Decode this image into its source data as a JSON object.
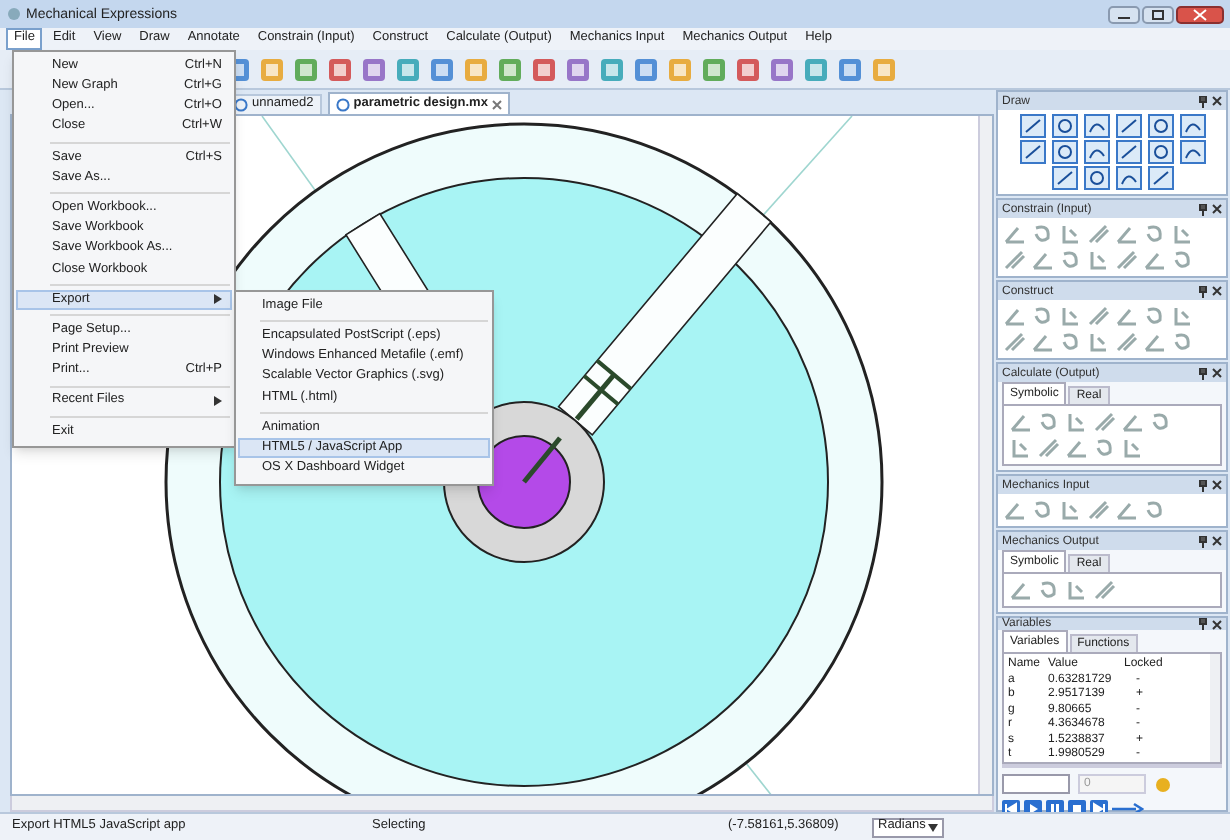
{
  "window": {
    "title": "Mechanical Expressions"
  },
  "menu_bar": [
    {
      "label": "File",
      "selected": true
    },
    {
      "label": "Edit",
      "selected": false
    },
    {
      "label": "View",
      "selected": false
    },
    {
      "label": "Draw",
      "selected": false
    },
    {
      "label": "Annotate",
      "selected": false
    },
    {
      "label": "Constrain (Input)",
      "selected": false
    },
    {
      "label": "Construct",
      "selected": false
    },
    {
      "label": "Calculate (Output)",
      "selected": false
    },
    {
      "label": "Mechanics Input",
      "selected": false
    },
    {
      "label": "Mechanics Output",
      "selected": false
    },
    {
      "label": "Help",
      "selected": false
    }
  ],
  "file_menu": [
    {
      "kind": "item",
      "label": "New",
      "shortcut": "Ctrl+N",
      "submenu": false,
      "selected": false
    },
    {
      "kind": "item",
      "label": "New Graph",
      "shortcut": "Ctrl+G",
      "submenu": false,
      "selected": false
    },
    {
      "kind": "item",
      "label": "Open...",
      "shortcut": "Ctrl+O",
      "submenu": false,
      "selected": false
    },
    {
      "kind": "item",
      "label": "Close",
      "shortcut": "Ctrl+W",
      "submenu": false,
      "selected": false
    },
    {
      "kind": "separator"
    },
    {
      "kind": "item",
      "label": "Save",
      "shortcut": "Ctrl+S",
      "submenu": false,
      "selected": false
    },
    {
      "kind": "item",
      "label": "Save As...",
      "submenu": false,
      "selected": false
    },
    {
      "kind": "separator"
    },
    {
      "kind": "item",
      "label": "Open Workbook...",
      "submenu": false,
      "selected": false
    },
    {
      "kind": "item",
      "label": "Save Workbook",
      "submenu": false,
      "selected": false
    },
    {
      "kind": "item",
      "label": "Save Workbook As...",
      "submenu": false,
      "selected": false
    },
    {
      "kind": "item",
      "label": "Close Workbook",
      "submenu": false,
      "selected": false
    },
    {
      "kind": "separator"
    },
    {
      "kind": "item",
      "label": "Export",
      "submenu": true,
      "selected": true
    },
    {
      "kind": "separator"
    },
    {
      "kind": "item",
      "label": "Page Setup...",
      "submenu": false,
      "selected": false
    },
    {
      "kind": "item",
      "label": "Print Preview",
      "submenu": false,
      "selected": false
    },
    {
      "kind": "item",
      "label": "Print...",
      "shortcut": "Ctrl+P",
      "submenu": false,
      "selected": false
    },
    {
      "kind": "separator"
    },
    {
      "kind": "item",
      "label": "Recent Files",
      "submenu": true,
      "selected": false
    },
    {
      "kind": "separator"
    },
    {
      "kind": "item",
      "label": "Exit",
      "submenu": false,
      "selected": false
    }
  ],
  "export_submenu": [
    {
      "kind": "item",
      "label": "Image File",
      "selected": false
    },
    {
      "kind": "separator"
    },
    {
      "kind": "item",
      "label": "Encapsulated PostScript (.eps)",
      "selected": false
    },
    {
      "kind": "item",
      "label": "Windows Enhanced Metafile (.emf)",
      "selected": false
    },
    {
      "kind": "item",
      "label": "Scalable Vector Graphics (.svg)",
      "selected": false
    },
    {
      "kind": "item",
      "label": "HTML (.html)",
      "selected": false
    },
    {
      "kind": "separator"
    },
    {
      "kind": "item",
      "label": "Animation",
      "selected": false
    },
    {
      "kind": "item",
      "label": "HTML5 / JavaScript App",
      "selected": true
    },
    {
      "kind": "item",
      "label": "OS X Dashboard Widget",
      "selected": false
    }
  ],
  "document_tabs": [
    {
      "label": "unnamed2",
      "selected": false,
      "closable": false
    },
    {
      "label": "parametric design.mx",
      "selected": true,
      "closable": true
    }
  ],
  "panels": {
    "draw": {
      "title": "Draw"
    },
    "constrain": {
      "title": "Constrain (Input)"
    },
    "construct": {
      "title": "Construct"
    },
    "calculate": {
      "title": "Calculate (Output)",
      "tabs": [
        {
          "label": "Symbolic",
          "selected": true
        },
        {
          "label": "Real",
          "selected": false
        }
      ]
    },
    "mechanics_input": {
      "title": "Mechanics Input"
    },
    "mechanics_output": {
      "title": "Mechanics Output",
      "tabs": [
        {
          "label": "Symbolic",
          "selected": true
        },
        {
          "label": "Real",
          "selected": false
        }
      ]
    },
    "variables": {
      "title": "Variables",
      "tabs": [
        {
          "label": "Variables",
          "selected": true
        },
        {
          "label": "Functions",
          "selected": false
        }
      ],
      "columns": [
        "Name",
        "Value",
        "Locked"
      ],
      "rows": [
        [
          "a",
          "0.63281729",
          "-"
        ],
        [
          "b",
          "2.9517139",
          "+"
        ],
        [
          "g",
          "9.80665",
          "-"
        ],
        [
          "r",
          "4.3634678",
          "-"
        ],
        [
          "s",
          "1.5238837",
          "+"
        ],
        [
          "t",
          "1.9980529",
          "-"
        ]
      ],
      "value_field": "0"
    }
  },
  "status_bar": {
    "message": "Export HTML5 JavaScript app",
    "mode": "Selecting",
    "coordinates": "(-7.58161,5.36809)",
    "angle_unit": "Radians"
  }
}
